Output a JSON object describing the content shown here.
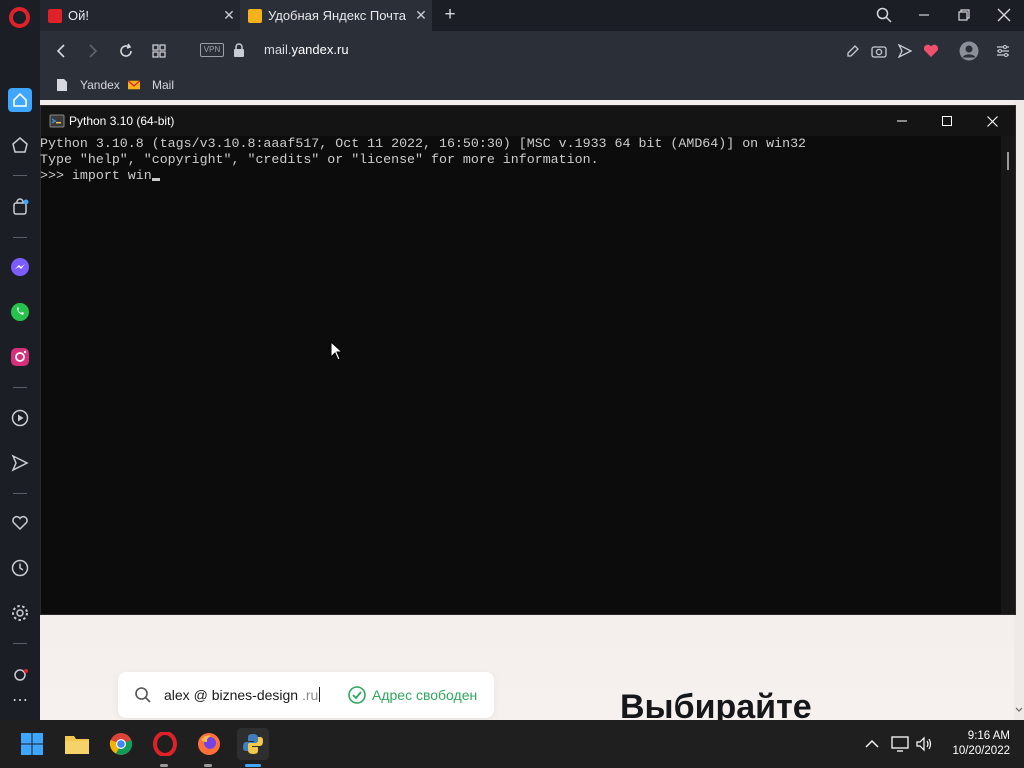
{
  "browser": {
    "tabs": [
      {
        "title": "Ой!",
        "favicon": "yandex-logo"
      },
      {
        "title": "Удобная Яндекс Почта с э",
        "favicon": "yandex-mail-logo",
        "active": true
      }
    ],
    "url_prefix": "mail.",
    "url_domain": "yandex.ru",
    "vpn_label": "VPN",
    "bookmarks": [
      {
        "label": "Yandex",
        "icon": "page-icon"
      },
      {
        "label": "Mail",
        "icon": "mail-icon"
      }
    ]
  },
  "page": {
    "email_local": "alex",
    "email_at": "@",
    "email_domain": "biznes-design",
    "email_tld": ".ru",
    "status": "Адрес свободен",
    "headline": "Выбирайте"
  },
  "console": {
    "title": "Python 3.10 (64-bit)",
    "lines": [
      "Python 3.10.8 (tags/v3.10.8:aaaf517, Oct 11 2022, 16:50:30) [MSC v.1933 64 bit (AMD64)] on win32",
      "Type \"help\", \"copyright\", \"credits\" or \"license\" for more information.",
      ">>> import win"
    ]
  },
  "taskbar": {
    "apps": [
      "start",
      "file-explorer",
      "chrome",
      "opera",
      "firefox",
      "python"
    ],
    "time": "9:16 AM",
    "date": "10/20/2022"
  },
  "colors": {
    "opera_red": "#e0212a",
    "console_bg": "#0c0c0c",
    "console_text": "#cccccc",
    "available_green": "#2fa75e",
    "accent_blue": "#3ea6ff"
  }
}
